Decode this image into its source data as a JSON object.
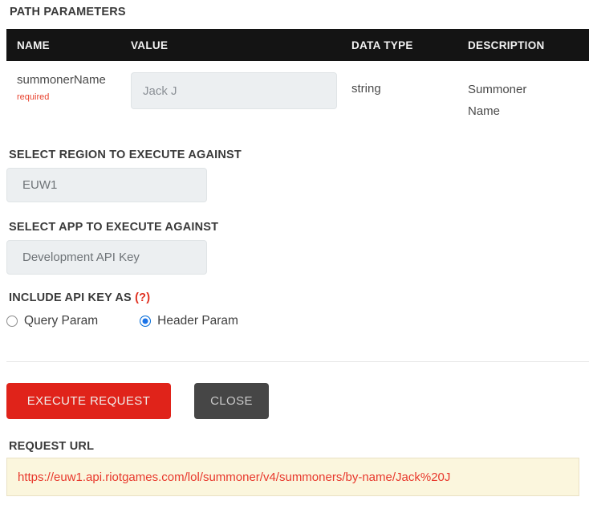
{
  "path_parameters": {
    "title": "PATH PARAMETERS",
    "columns": {
      "name": "NAME",
      "value": "VALUE",
      "data_type": "DATA TYPE",
      "description": "DESCRIPTION"
    },
    "rows": [
      {
        "name": "summonerName",
        "required_label": "required",
        "value": "Jack J",
        "placeholder": "Jack J",
        "data_type": "string",
        "description": "Summoner Name"
      }
    ]
  },
  "region": {
    "label": "SELECT REGION TO EXECUTE AGAINST",
    "selected": "EUW1"
  },
  "app": {
    "label": "SELECT APP TO EXECUTE AGAINST",
    "selected": "Development API Key"
  },
  "api_key": {
    "label": "INCLUDE API KEY AS",
    "help_marker": "(?)",
    "options": [
      {
        "label": "Query Param",
        "selected": false
      },
      {
        "label": "Header Param",
        "selected": true
      }
    ]
  },
  "actions": {
    "execute_label": "EXECUTE REQUEST",
    "close_label": "CLOSE"
  },
  "request_url": {
    "label": "REQUEST URL",
    "url": "https://euw1.api.riotgames.com/lol/summoner/v4/summoners/by-name/Jack%20J"
  },
  "colors": {
    "header_bar": "#141414",
    "execute_button": "#e0231a",
    "close_button": "#464646",
    "required_text": "#e8432f",
    "url_text": "#e8382c",
    "url_background": "#fbf6dd",
    "radio_selected": "#1a73e8",
    "input_background": "#eceff1"
  }
}
